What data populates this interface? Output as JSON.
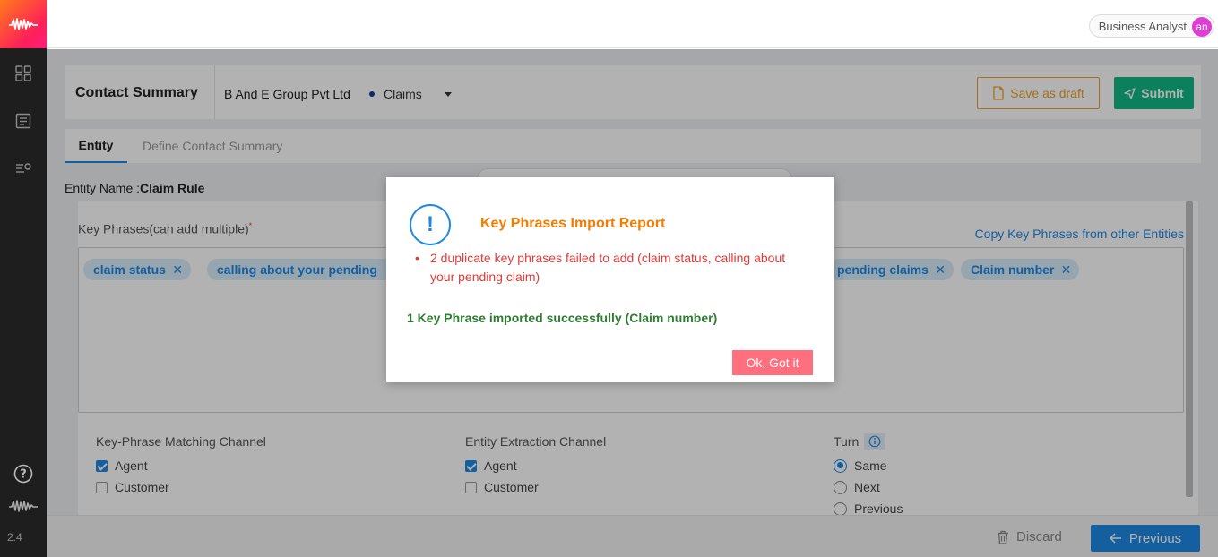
{
  "app": {
    "version": "2.4",
    "user_role": "Business Analyst",
    "user_initials": "an"
  },
  "sidebar": {
    "icons": [
      "dashboard-icon",
      "document-icon",
      "settings-list-icon",
      "help-icon",
      "brand-wave-icon"
    ]
  },
  "summary": {
    "title": "Contact Summary",
    "company": "B And E Group Pvt Ltd",
    "category": "Claims",
    "save_draft_label": "Save as draft",
    "submit_label": "Submit"
  },
  "tabs": [
    {
      "label": "Entity"
    },
    {
      "label": "Define Contact Summary"
    }
  ],
  "entity": {
    "name_label": "Entity Name :",
    "name_value": "Claim Rule"
  },
  "key_phrases": {
    "label": "Key Phrases(can add multiple)",
    "required_mark": "*",
    "copy_link": "Copy Key Phrases from other Entities",
    "chips": [
      "claim status",
      "calling about your pending",
      "pending claims",
      "Claim number"
    ]
  },
  "options": {
    "kp_channel": {
      "title": "Key-Phrase Matching Channel",
      "items": [
        "Agent",
        "Customer"
      ],
      "checked": [
        true,
        false
      ]
    },
    "ee_channel": {
      "title": "Entity Extraction Channel",
      "items": [
        "Agent",
        "Customer"
      ],
      "checked": [
        true,
        false
      ]
    },
    "turn": {
      "title": "Turn",
      "items": [
        "Same",
        "Next",
        "Previous"
      ],
      "selected": "Same"
    }
  },
  "footer": {
    "discard_label": "Discard",
    "previous_label": "Previous"
  },
  "modal": {
    "title": "Key Phrases Import Report",
    "error": "2 duplicate key phrases failed to add (claim status, calling about your pending claim)",
    "success": "1 Key Phrase imported successfully (Claim number)",
    "button": "Ok, Got it"
  },
  "colors": {
    "accent": "#1e88e5",
    "submit": "#12b886",
    "draft": "#f0a02a",
    "error": "#e53935",
    "success": "#2e7d32",
    "modal_button": "#ff6f7d",
    "modal_title": "#f57c00"
  }
}
